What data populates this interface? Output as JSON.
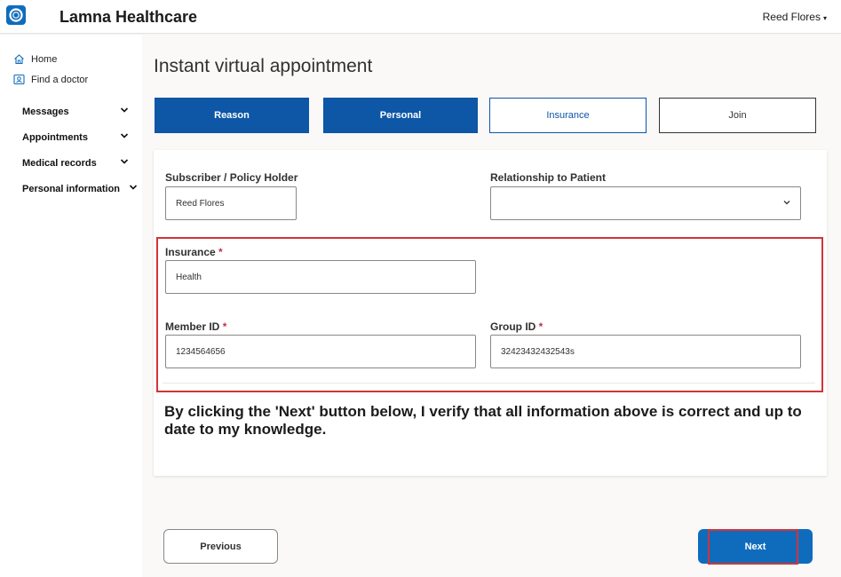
{
  "header": {
    "app_title": "Lamna Healthcare",
    "user_name": "Reed Flores",
    "user_caret": "▾",
    "logo_icon": "ring-logo-icon"
  },
  "sidebar": {
    "links": [
      {
        "label": "Home",
        "icon": "home-icon"
      },
      {
        "label": "Find a doctor",
        "icon": "id-card-icon"
      }
    ],
    "groups": [
      {
        "label": "Messages",
        "chevron": "⌄"
      },
      {
        "label": "Appointments",
        "chevron": "⌄"
      },
      {
        "label": "Medical records",
        "chevron": "⌄"
      },
      {
        "label": "Personal information",
        "chevron": "⌄"
      }
    ]
  },
  "main": {
    "title": "Instant virtual appointment",
    "steps": [
      {
        "label": "Reason",
        "state": "completed"
      },
      {
        "label": "Personal",
        "state": "completed"
      },
      {
        "label": "Insurance",
        "state": "current"
      },
      {
        "label": "Join",
        "state": "upcoming"
      }
    ],
    "form": {
      "subscriber": {
        "label": "Subscriber / Policy Holder",
        "value": "Reed Flores"
      },
      "relationship": {
        "label": "Relationship to Patient",
        "value": ""
      },
      "insurance": {
        "label": "Insurance",
        "required_mark": "*",
        "value": "Health"
      },
      "member_id": {
        "label": "Member ID",
        "required_mark": "*",
        "value": "1234564656"
      },
      "group_id": {
        "label": "Group ID",
        "required_mark": "*",
        "value": "32423432432543s"
      }
    },
    "verify_text": "By clicking the 'Next' button below, I verify that all information above is correct and up to date to my knowledge.",
    "buttons": {
      "previous": "Previous",
      "next": "Next"
    }
  },
  "colors": {
    "primary": "#0e56a6",
    "accent": "#0f6cbd",
    "highlight": "#d13438",
    "required": "#c4314b"
  }
}
